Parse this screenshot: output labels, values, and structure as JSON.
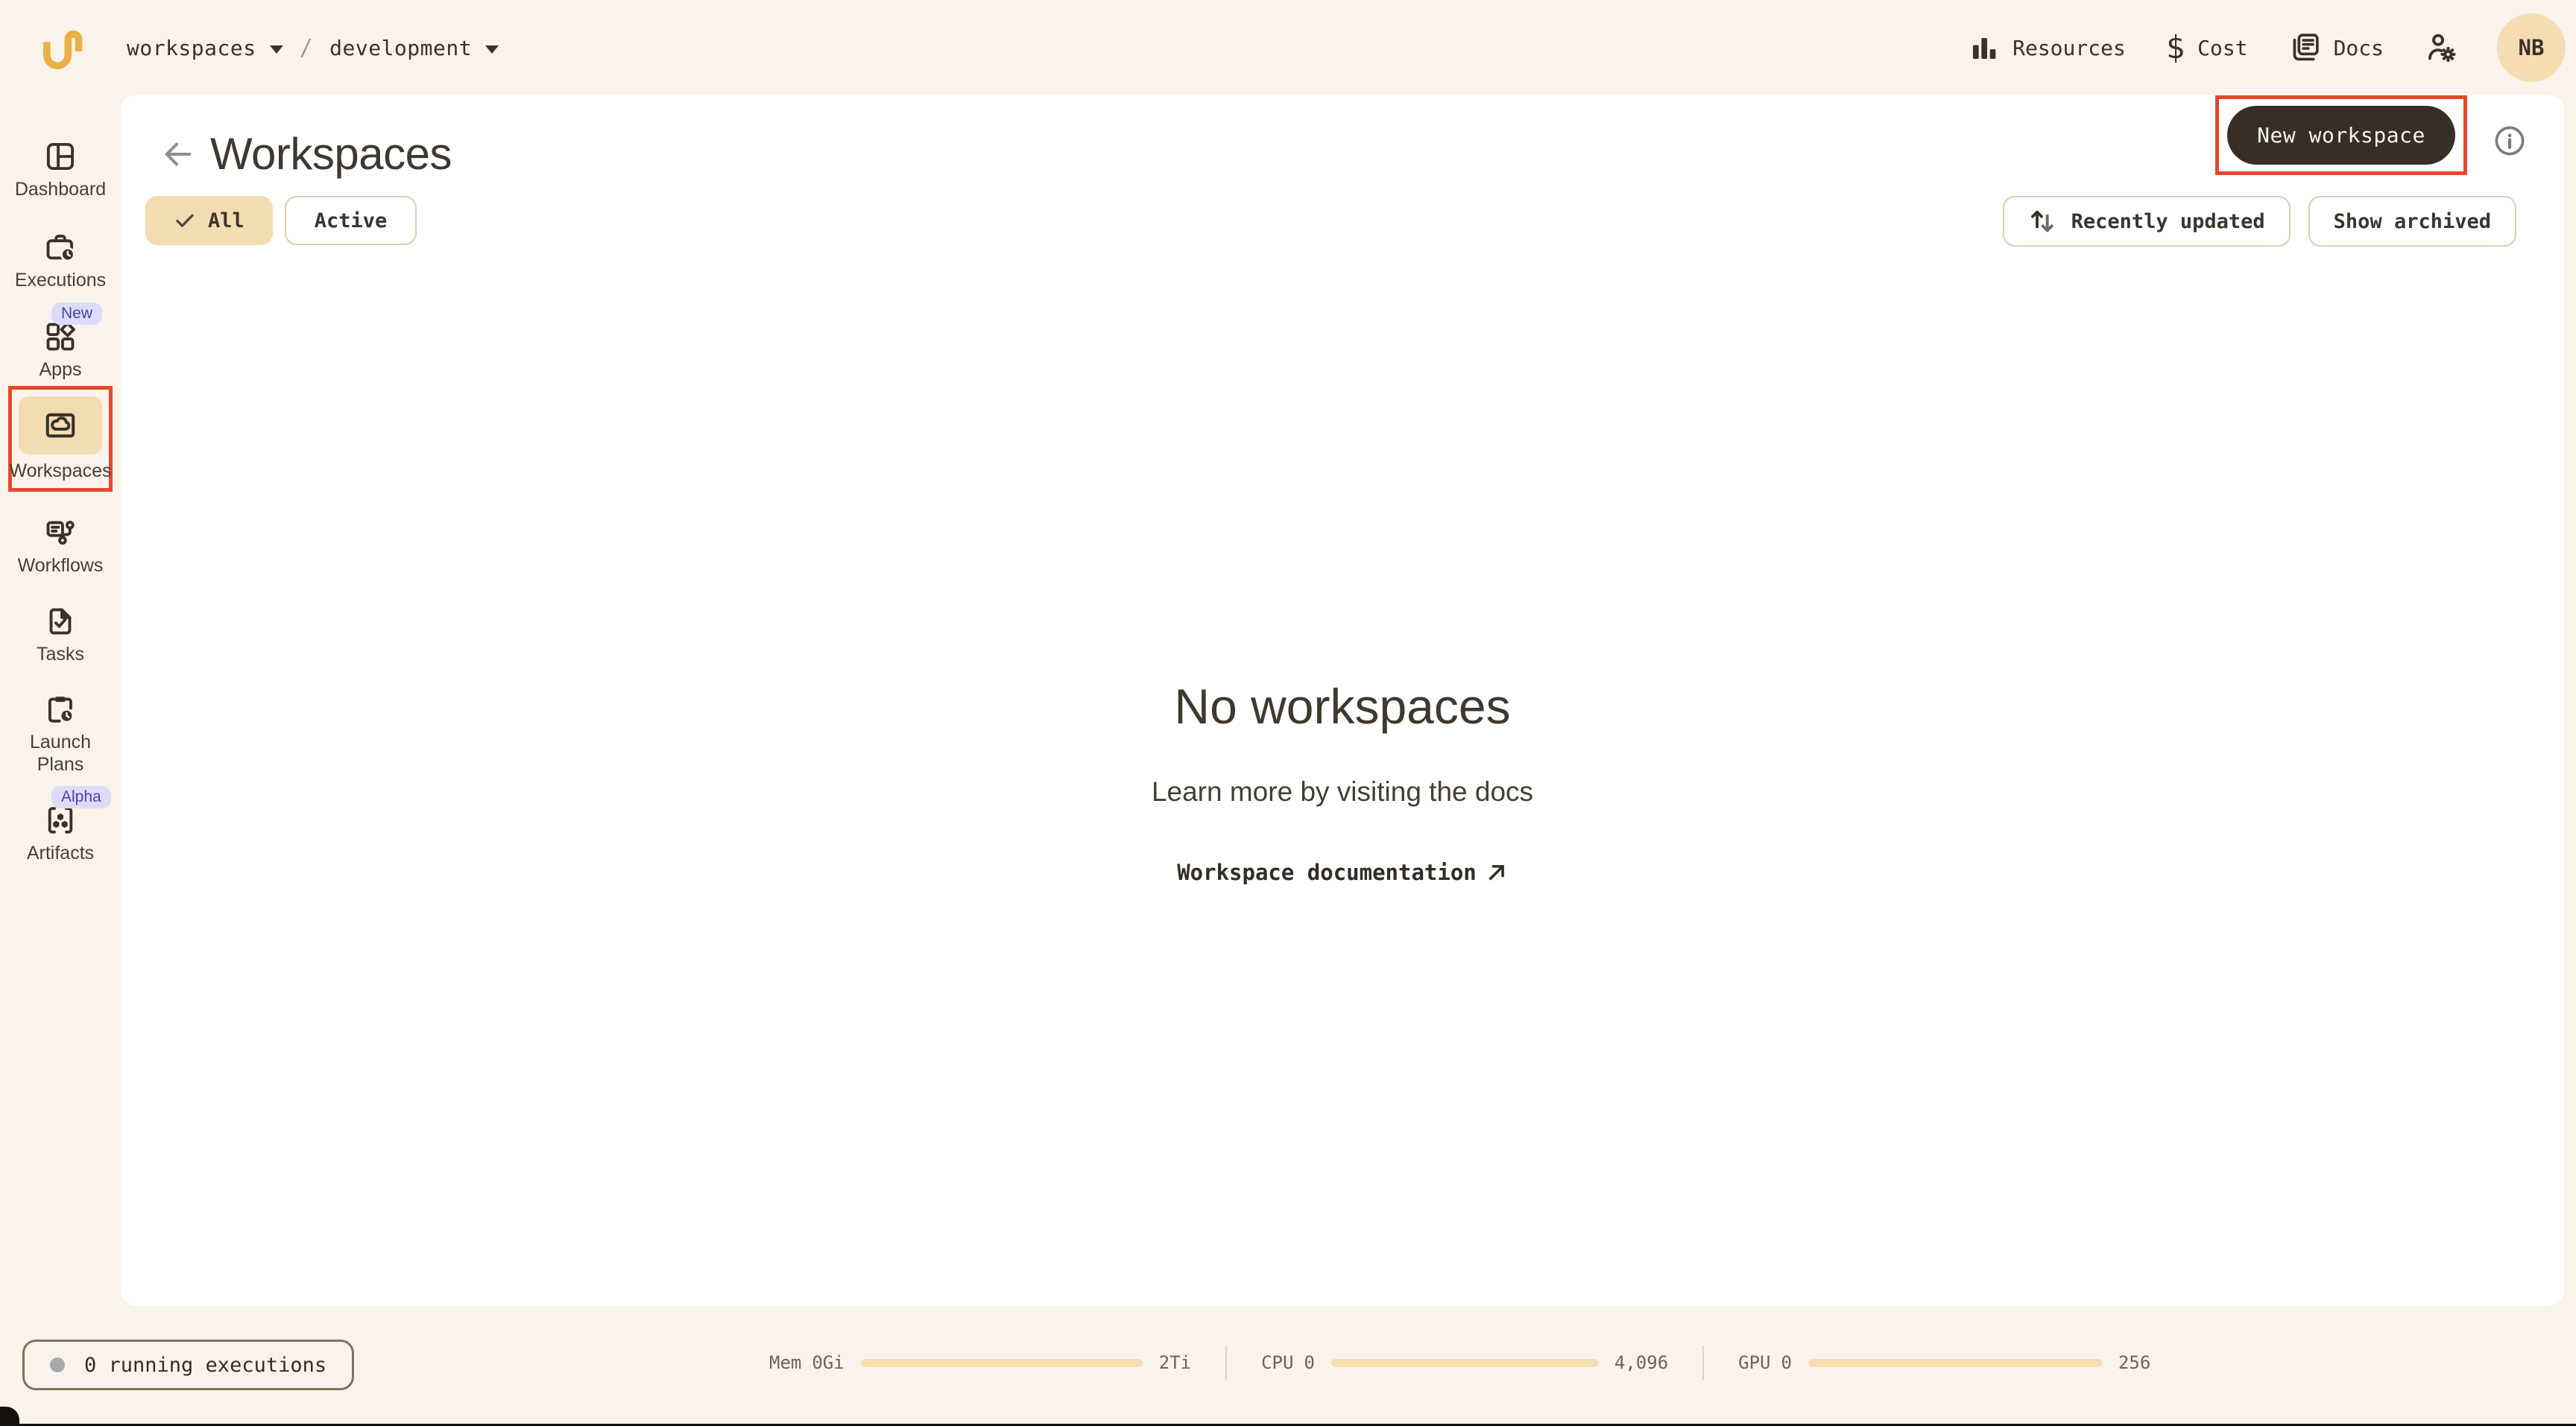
{
  "topbar": {
    "breadcrumb": {
      "project": "workspaces",
      "separator": "/",
      "domain": "development"
    },
    "nav": {
      "resources": "Resources",
      "cost": "Cost",
      "docs": "Docs"
    },
    "avatar_initials": "NB"
  },
  "sidebar": {
    "items": [
      {
        "label": "Dashboard"
      },
      {
        "label": "Executions"
      },
      {
        "label": "Apps",
        "badge": "New"
      },
      {
        "label": "Workspaces",
        "active": true
      },
      {
        "label": "Workflows"
      },
      {
        "label": "Tasks"
      },
      {
        "label": "Launch Plans"
      },
      {
        "label": "Artifacts",
        "badge": "Alpha"
      }
    ]
  },
  "header": {
    "title": "Workspaces",
    "new_workspace_label": "New workspace"
  },
  "filters": {
    "all_label": "All",
    "active_label": "Active",
    "sort_label": "Recently updated",
    "archived_label": "Show archived"
  },
  "empty_state": {
    "title": "No workspaces",
    "subtitle": "Learn more by visiting the docs",
    "link_label": "Workspace documentation"
  },
  "statusbar": {
    "running_label": "0 running executions",
    "meters": [
      {
        "name": "Mem",
        "used": "0Gi",
        "capacity": "2Ti"
      },
      {
        "name": "CPU",
        "used": "0",
        "capacity": "4,096"
      },
      {
        "name": "GPU",
        "used": "0",
        "capacity": "256"
      }
    ]
  },
  "colors": {
    "accent_amber": "#eab244",
    "annotation_red": "#e8472c",
    "active_tan": "#f3dcb2",
    "button_dark": "#362e27",
    "badge_purple_bg": "#dedbf8",
    "badge_purple_text": "#4a42a8"
  }
}
